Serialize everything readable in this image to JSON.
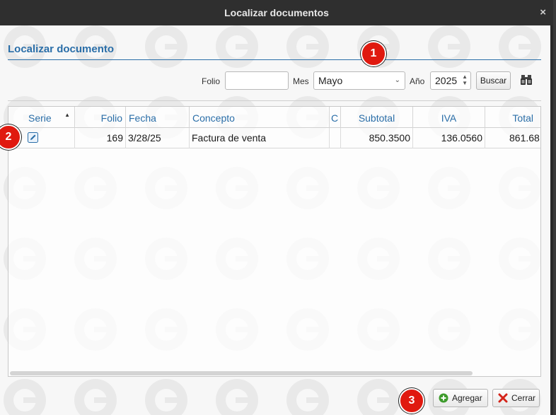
{
  "window": {
    "title": "Localizar documentos",
    "close_glyph": "×"
  },
  "section": {
    "title": "Localizar documento"
  },
  "filters": {
    "folio_label": "Folio",
    "folio_value": "",
    "mes_label": "Mes",
    "mes_value": "Mayo",
    "anio_label": "Año",
    "anio_value": "2025",
    "buscar_label": "Buscar"
  },
  "grid": {
    "columns": [
      "Serie",
      "Folio",
      "Fecha",
      "Concepto",
      "C",
      "Subtotal",
      "IVA",
      "Total"
    ],
    "rows": [
      {
        "serie": "",
        "folio": "169",
        "fecha": "3/28/25",
        "concepto": "Factura de venta",
        "c": "",
        "subtotal": "850.3500",
        "iva": "136.0560",
        "total": "861.68"
      }
    ]
  },
  "footer": {
    "agregar_label": "Agregar",
    "cerrar_label": "Cerrar"
  },
  "badges": [
    "1",
    "2",
    "3"
  ],
  "icons": {
    "edit": "edit-icon",
    "binoculars": "binoculars-icon",
    "add": "add-circle-icon",
    "close": "close-icon",
    "sort": "sort-ascending-icon"
  },
  "colors": {
    "accent": "#2a6ea8",
    "badge": "#e0190f",
    "titlebar": "#2f2f2f"
  }
}
